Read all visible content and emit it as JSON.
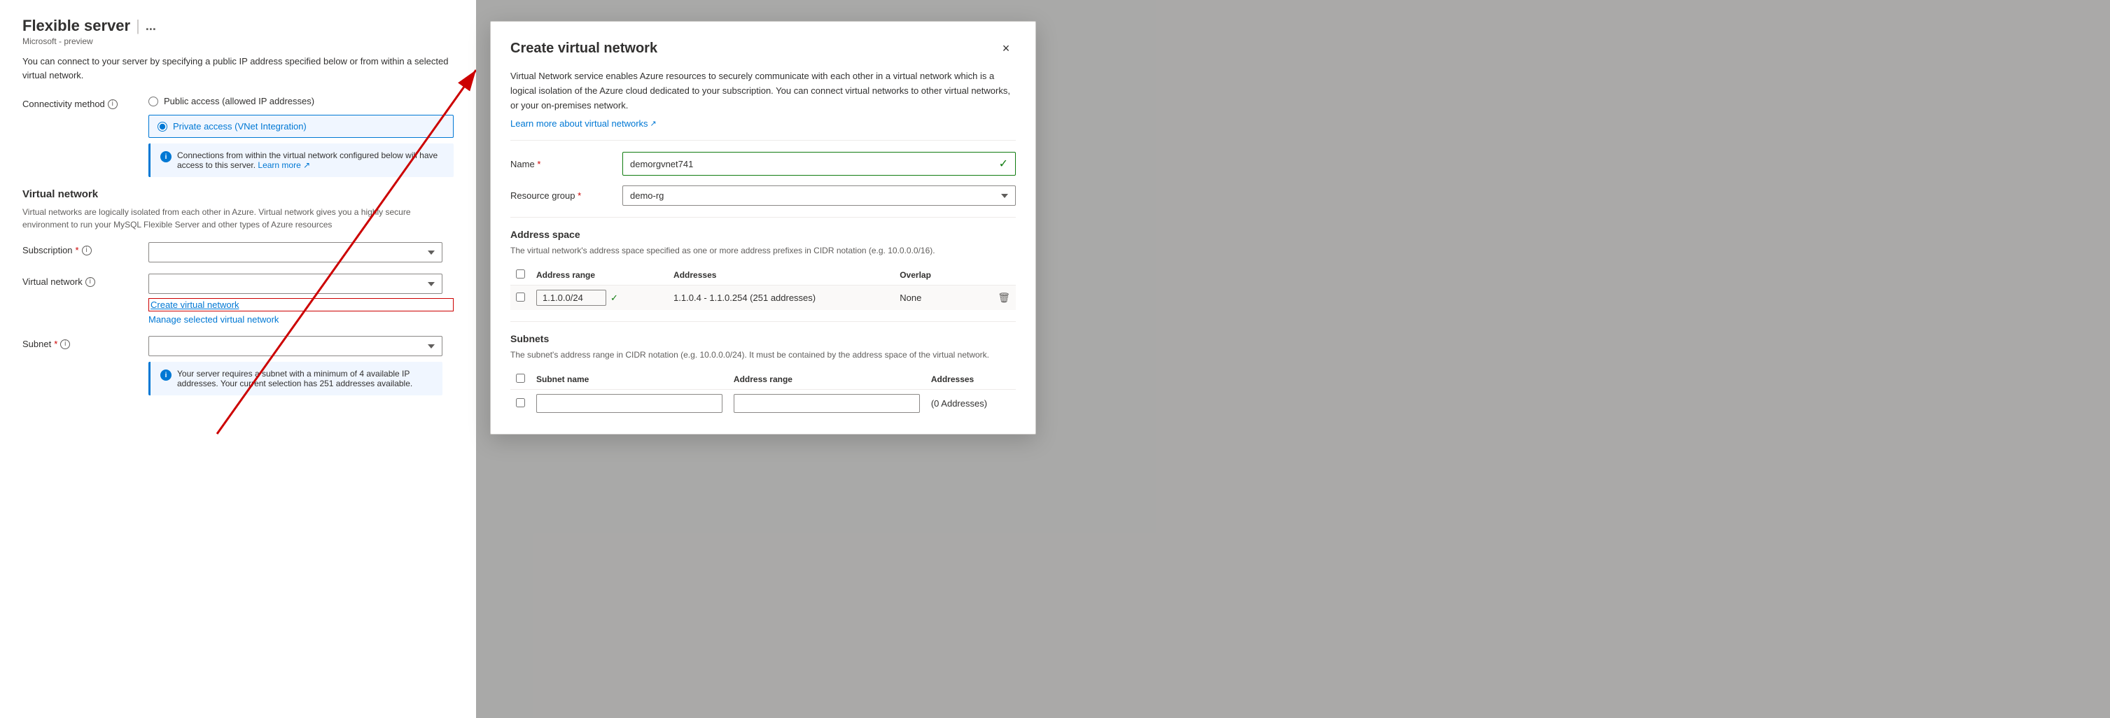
{
  "leftPanel": {
    "title": "Flexible server",
    "titleSeparator": "|",
    "ellipsis": "...",
    "subtitle": "Microsoft - preview",
    "description": "You can connect to your server by specifying a public IP address specified below or from within a selected virtual network.",
    "connectivitySection": {
      "label": "Connectivity method",
      "infoTooltip": "i",
      "options": [
        {
          "id": "public-access",
          "label": "Public access (allowed IP addresses)",
          "selected": false
        },
        {
          "id": "private-access",
          "label": "Private access (VNet Integration)",
          "selected": true
        }
      ],
      "infoBoxText": "Connections from within the virtual network configured below will have access to this server.",
      "infoBoxLinkText": "Learn more",
      "infoBoxLinkIcon": "↗"
    },
    "virtualNetworkSection": {
      "sectionTitle": "Virtual network",
      "sectionDesc": "Virtual networks are logically isolated from each other in Azure. Virtual network gives you a highly secure environment to run your MySQL Flexible Server and other types of Azure resources",
      "subscriptionLabel": "Subscription",
      "subscriptionRequired": true,
      "subscriptionValue": "",
      "virtualNetworkLabel": "Virtual network",
      "virtualNetworkRequired": false,
      "virtualNetworkValue": "",
      "createVnetLink": "Create virtual network",
      "manageVnetLink": "Manage selected virtual network",
      "subnetLabel": "Subnet",
      "subnetRequired": true,
      "subnetValue": "",
      "subnetInfoText": "Your server requires a subnet with a minimum of 4 available IP addresses. Your current selection has 251 addresses available."
    }
  },
  "modal": {
    "title": "Create virtual network",
    "closeLabel": "×",
    "description": "Virtual Network service enables Azure resources to securely communicate with each other in a virtual network which is a logical isolation of the Azure cloud dedicated to your subscription. You can connect virtual networks to other virtual networks, or your on-premises network.",
    "learnMoreText": "Learn more about virtual networks",
    "learnMoreIcon": "↗",
    "nameLabel": "Name",
    "nameRequired": true,
    "nameValue": "demorgvnet741",
    "nameValid": true,
    "resourceGroupLabel": "Resource group",
    "resourceGroupRequired": true,
    "resourceGroupValue": "demo-rg",
    "addressSpaceTitle": "Address space",
    "addressSpaceDesc": "The virtual network's address space specified as one or more address prefixes in CIDR notation (e.g. 10.0.0.0/16).",
    "addressTable": {
      "columns": [
        "",
        "Address range",
        "Addresses",
        "Overlap"
      ],
      "rows": [
        {
          "checked": false,
          "range": "1.1.0.0/24",
          "rangeValid": true,
          "addresses": "1.1.0.4 - 1.1.0.254 (251 addresses)",
          "overlap": "None",
          "deleteIcon": "🗑"
        }
      ]
    },
    "subnetsTitle": "Subnets",
    "subnetsDesc": "The subnet's address range in CIDR notation (e.g. 10.0.0.0/24). It must be contained by the address space of the virtual network.",
    "subnetTable": {
      "columns": [
        "",
        "Subnet name",
        "Address range",
        "Addresses"
      ],
      "rows": [
        {
          "checked": false,
          "name": "",
          "range": "",
          "addresses": "(0 Addresses)"
        }
      ]
    }
  }
}
